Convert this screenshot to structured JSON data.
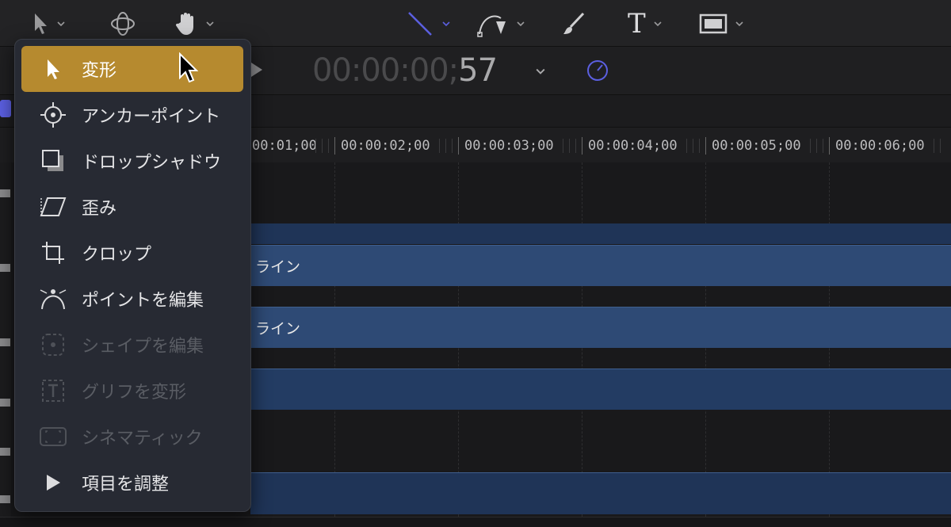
{
  "toolbar": {
    "tools": [
      {
        "name": "select-tool",
        "icon": "arrow-pointer-icon"
      },
      {
        "name": "orbit-tool",
        "icon": "3d-orbit-icon"
      },
      {
        "name": "pan-tool",
        "icon": "hand-icon"
      },
      {
        "name": "line-tool",
        "icon": "line-icon",
        "color": "#5b5fe0"
      },
      {
        "name": "bezier-tool",
        "icon": "pen-icon"
      },
      {
        "name": "paint-tool",
        "icon": "brush-icon"
      },
      {
        "name": "text-tool",
        "icon": "text-icon"
      },
      {
        "name": "shape-tool",
        "icon": "rectangle-icon"
      }
    ],
    "text_tool_glyph": "T"
  },
  "transport": {
    "timecode_dim": "00:00:00;",
    "timecode_bright": "57"
  },
  "ruler": {
    "labels": [
      "00:01;00",
      "00:00:02;00",
      "00:00:03;00",
      "00:00:04;00",
      "00:00:05;00",
      "00:00:06;00"
    ]
  },
  "tracks": {
    "clips": [
      {
        "label": ""
      },
      {
        "label": "ライン"
      },
      {
        "label": "ライン"
      },
      {
        "label": ""
      },
      {
        "label": ""
      }
    ]
  },
  "menu": {
    "items": [
      {
        "label": "変形",
        "icon": "arrow-pointer-icon",
        "state": "selected"
      },
      {
        "label": "アンカーポイント",
        "icon": "anchor-point-icon",
        "state": "enabled"
      },
      {
        "label": "ドロップシャドウ",
        "icon": "drop-shadow-icon",
        "state": "enabled"
      },
      {
        "label": "歪み",
        "icon": "distort-icon",
        "state": "enabled"
      },
      {
        "label": "クロップ",
        "icon": "crop-icon",
        "state": "enabled"
      },
      {
        "label": "ポイントを編集",
        "icon": "edit-points-icon",
        "state": "enabled"
      },
      {
        "label": "シェイプを編集",
        "icon": "edit-shape-icon",
        "state": "disabled"
      },
      {
        "label": "グリフを変形",
        "icon": "transform-glyph-icon",
        "state": "disabled"
      },
      {
        "label": "シネマティック",
        "icon": "cinematic-icon",
        "state": "disabled"
      },
      {
        "label": "項目を調整",
        "icon": "adjust-item-icon",
        "state": "enabled"
      }
    ]
  },
  "colors": {
    "selected": "#b68a2f",
    "clip": "#2e4a75",
    "accent": "#5b5fe0"
  }
}
